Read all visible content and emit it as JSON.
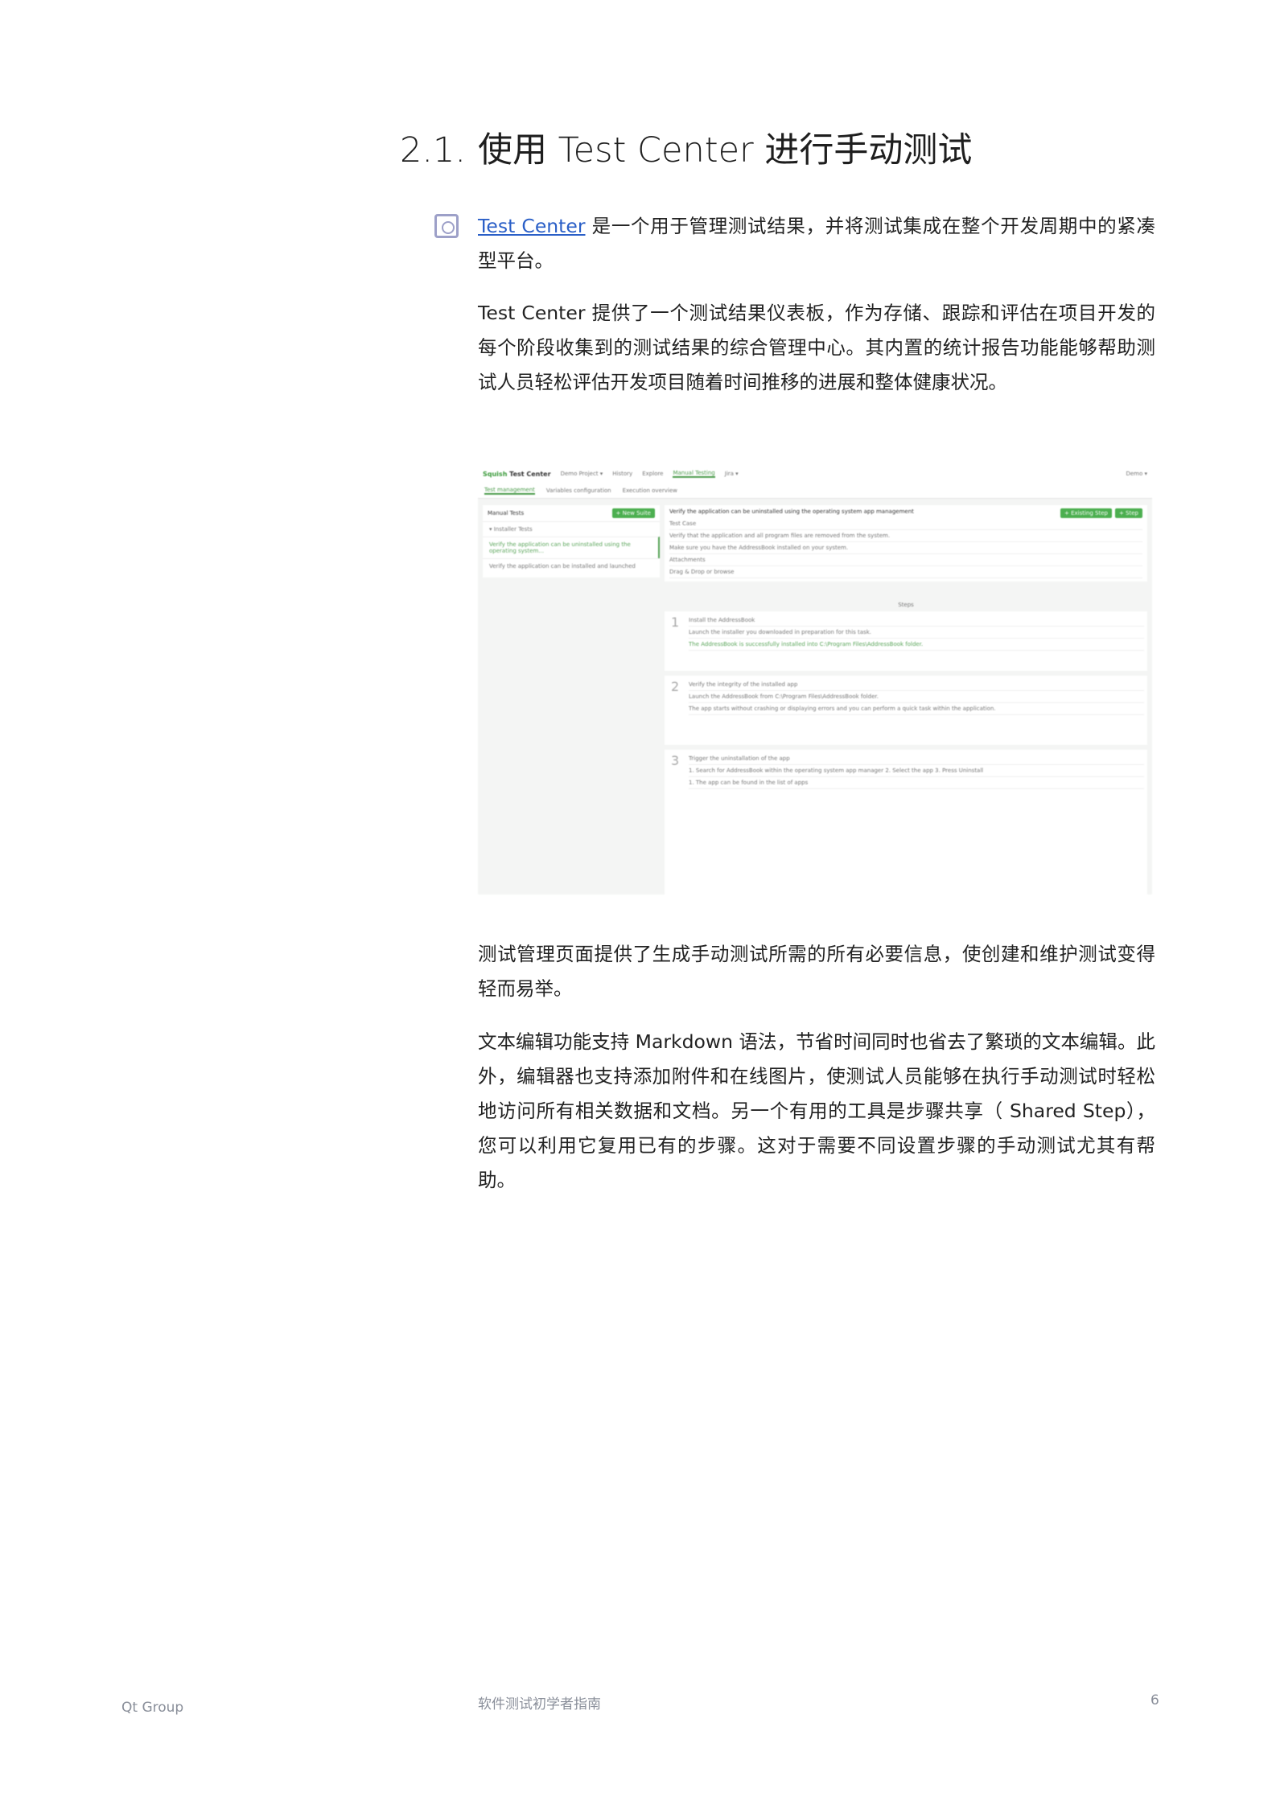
{
  "heading": {
    "number": "2.1.",
    "text": "使用 Test Center 进行手动测试"
  },
  "paragraphs": {
    "p1_link": "Test Center",
    "p1_rest": " 是一个用于管理测试结果，并将测试集成在整个开发周期中的紧凑型平台。",
    "p2": "Test Center 提供了一个测试结果仪表板，作为存储、跟踪和评估在项目开发的每个阶段收集到的测试结果的综合管理中心。其内置的统计报告功能能够帮助测试人员轻松评估开发项目随着时间推移的进展和整体健康状况。",
    "p3": "测试管理页面提供了生成手动测试所需的所有必要信息，使创建和维护测试变得轻而易举。",
    "p4": "文本编辑功能支持 Markdown 语法，节省时间同时也省去了繁琐的文本编辑。此外，编辑器也支持添加附件和在线图片，使测试人员能够在执行手动测试时轻松地访问所有相关数据和文档。另一个有用的工具是步骤共享（ Shared Step），您可以利用它复用已有的步骤。这对于需要不同设置步骤的手动测试尤其有帮助。"
  },
  "screenshot": {
    "logo_a": "Squish ",
    "logo_b": "Test Center",
    "nav": [
      "Demo Project ▾",
      "History",
      "Explore",
      "Manual Testing",
      "Jira ▾"
    ],
    "user": "Demo ▾",
    "subtabs": [
      "Test management",
      "Variables configuration",
      "Execution overview"
    ],
    "left_title": "Manual Tests",
    "new_suite": "+ New Suite",
    "suite": "▾ Installer Tests",
    "tests": [
      "Verify the application can be uninstalled using the operating system...",
      "Verify the application can be installed and launched"
    ],
    "case_title": "Verify the application can be uninstalled using the operating system app management",
    "case_type": "Test Case",
    "btn_shared": "+ Existing Step",
    "btn_step": "+ Step",
    "desc": "Verify that the application and all program files are removed from the system.",
    "precond": "Make sure you have the AddressBook installed on your system.",
    "attachments": "Attachments",
    "drop": "Drag & Drop or browse",
    "steps_label": "Steps",
    "steps": [
      {
        "n": "1",
        "title": "Install the AddressBook",
        "desc": "Launch the installer you downloaded in preparation for this task.",
        "exp": "The AddressBook is successfully installed into C:\\Program Files\\AddressBook folder."
      },
      {
        "n": "2",
        "title": "Verify the integrity of the installed app",
        "desc": "Launch the AddressBook from C:\\Program Files\\AddressBook folder.",
        "exp": "The app starts without crashing or displaying errors and you can perform a quick task within the application."
      },
      {
        "n": "3",
        "title": "Trigger the uninstallation of the app",
        "desc": "1. Search for AddressBook within the operating system app manager  2. Select the app  3. Press Uninstall",
        "exp": "1. The app can be found in the list of apps"
      }
    ]
  },
  "footer": {
    "left": "Qt Group",
    "center": "软件测试初学者指南",
    "page": "6"
  },
  "colors": {
    "link": "#2a5fc7",
    "accent_green": "#4caf50",
    "icon": "#9da0c8"
  }
}
